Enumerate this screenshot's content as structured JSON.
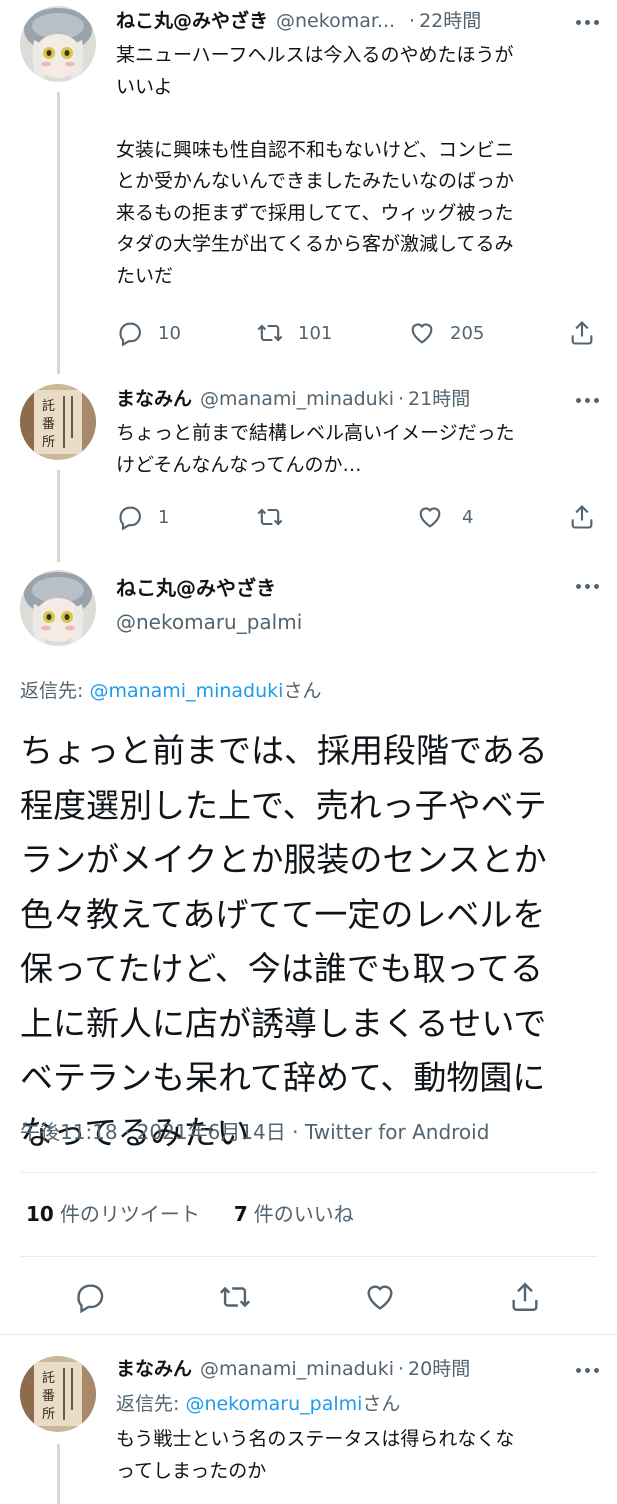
{
  "tweet1": {
    "name": "ねこ丸@みやざき",
    "handle": "@nekomar...",
    "dot": "·",
    "time": "22時間",
    "body": "某ニューハーフヘルスは今入るのやめたほうが\nいいよ\n\n女装に興味も性自認不和もないけど、コンビニ\nとか受かんないんできましたみたいなのばっか\n来るもの拒まずで採用してて、ウィッグ被った\nタダの大学生が出てくるから客が激減してるみ\nたいだ",
    "replies": "10",
    "retweets": "101",
    "likes": "205"
  },
  "tweet2": {
    "name": "まなみん",
    "handle": "@manami_minaduki",
    "dot": "·",
    "time": "21時間",
    "body": "ちょっと前まで結構レベル高いイメージだった\nけどそんなんなってんのか…",
    "replies": "1",
    "retweets": "",
    "likes": "4"
  },
  "focus": {
    "name": "ねこ丸@みやざき",
    "handle": "@nekomaru_palmi",
    "replyto_prefix": "返信先: ",
    "replyto_user": "@manami_minaduki",
    "replyto_suffix": "さん",
    "body": "ちょっと前までは、採用段階である\n程度選別した上で、売れっ子やベテ\nランがメイクとか服装のセンスとか\n色々教えてあげてて一定のレベルを\n保ってたけど、今は誰でも取ってる\n上に新人に店が誘導しまくるせいで\nベテランも呆れて辞めて、動物園に\nなってるみたい",
    "meta": "午後11:18 · 2021年6月14日 · Twitter for Android",
    "retweet_count": "10",
    "retweet_label": "件のリツイート",
    "like_count": "7",
    "like_label": "件のいいね"
  },
  "tweet3": {
    "name": "まなみん",
    "handle": "@manami_minaduki",
    "dot": "·",
    "time": "20時間",
    "replyto_prefix": "返信先: ",
    "replyto_user": "@nekomaru_palmi",
    "replyto_suffix": "さん",
    "body": "もう戦士という名のステータスは得られなくな\nってしまったのか"
  },
  "icons": {
    "reply": "reply-icon",
    "retweet": "retweet-icon",
    "like": "heart-icon",
    "share": "share-icon",
    "more": "more-icon"
  },
  "colors": {
    "link": "#1d9bf0",
    "secondary": "#536471",
    "primary": "#0f1419",
    "thread_line": "#cfd9de"
  }
}
